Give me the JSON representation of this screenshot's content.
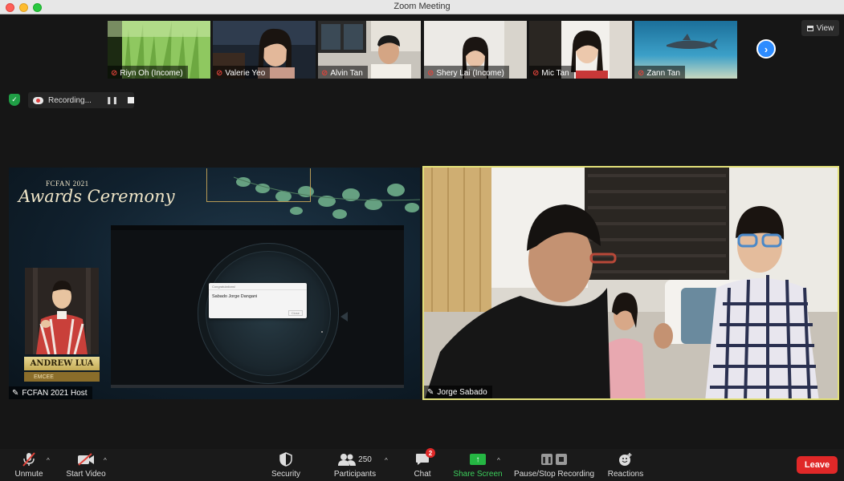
{
  "window": {
    "title": "Zoom Meeting"
  },
  "gallery": [
    {
      "name": "Riyn Oh (Income)"
    },
    {
      "name": "Valerie Yeo"
    },
    {
      "name": "Alvin Tan"
    },
    {
      "name": "Shery Lai (Income)"
    },
    {
      "name": "Mic Tan"
    },
    {
      "name": "Zann Tan"
    }
  ],
  "view_label": "View",
  "recording": {
    "status": "Recording...",
    "pause_icon": "pause-icon",
    "stop_icon": "stop-icon"
  },
  "share": {
    "brand_top": "FCFAN 2021",
    "brand_title": "Awards Ceremony",
    "dialog_title": "Congratulations!",
    "dialog_text": "Sabado Jorge Dangani",
    "dialog_button": "Close",
    "host_name_plate": "ANDREW LUA",
    "host_role": "EMCEE",
    "participant_label": "FCFAN 2021 Host"
  },
  "speaker": {
    "name": "Jorge Sabado"
  },
  "toolbar": {
    "unmute": "Unmute",
    "start_video": "Start Video",
    "security": "Security",
    "participants": "Participants",
    "participants_count": "250",
    "chat": "Chat",
    "chat_badge": "2",
    "share_screen": "Share Screen",
    "recording": "Pause/Stop Recording",
    "reactions": "Reactions",
    "leave": "Leave"
  },
  "colors": {
    "leave": "#e02828",
    "share_green": "#25b643",
    "active_speaker_border": "#e2e079",
    "next_arrow": "#2d8cff"
  }
}
